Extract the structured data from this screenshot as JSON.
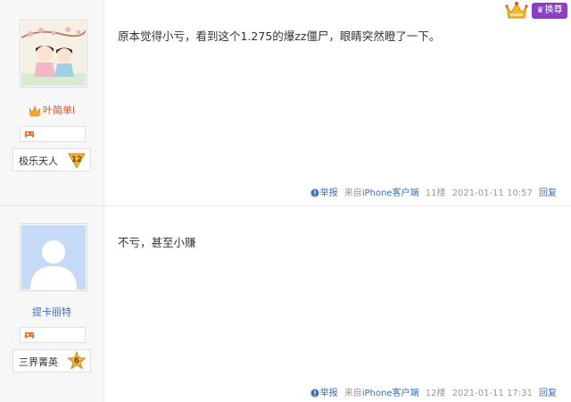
{
  "header": {
    "vip_button_label": "换尊"
  },
  "posts": [
    {
      "username": "叶简单l",
      "level_title": "极乐天人",
      "level_number": "12",
      "content": "原本觉得小亏，看到这个1.275的爆zz僵尸，眼睛突然瞪了一下。",
      "report_label": "举报",
      "source": "来自iPhone客户端",
      "floor": "11楼",
      "timestamp": "2021-01-11 10:57",
      "reply_label": "回复"
    },
    {
      "username": "提卡丽特",
      "level_title": "三界菁英",
      "level_number": "6",
      "content": "不亏，甚至小赚",
      "report_label": "举报",
      "source": "来自iPhone客户端",
      "floor": "12楼",
      "timestamp": "2021-01-11 17:31",
      "reply_label": "回复"
    }
  ],
  "colors": {
    "username_vip": "#e04f2a",
    "username_normal": "#3b6fb6",
    "link": "#3b6fb6",
    "meta": "#999999",
    "vip_button": "#8b3fc4"
  }
}
